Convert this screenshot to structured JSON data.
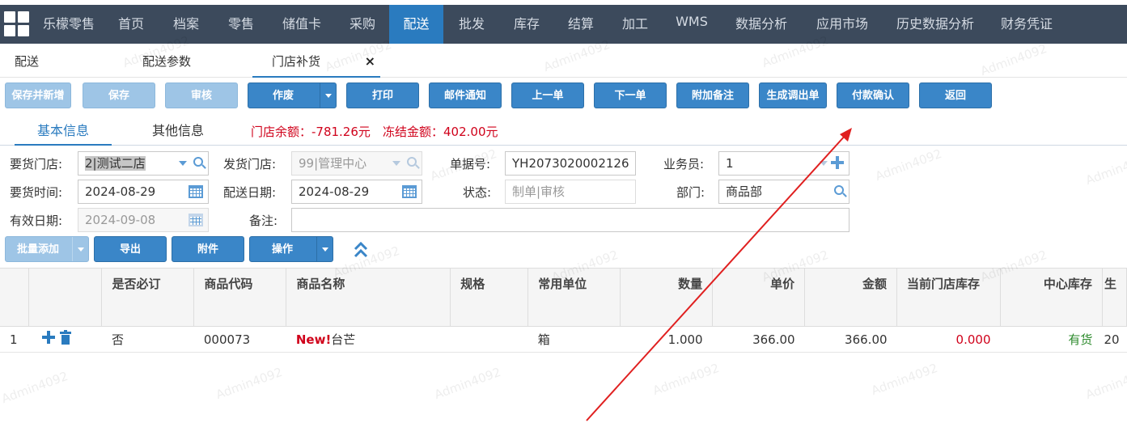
{
  "nav": {
    "items": [
      "乐檬零售",
      "首页",
      "档案",
      "零售",
      "储值卡",
      "采购",
      "配送",
      "批发",
      "库存",
      "结算",
      "加工",
      "WMS",
      "数据分析",
      "应用市场",
      "历史数据分析",
      "财务凭证"
    ],
    "active": "配送"
  },
  "tabs": [
    {
      "label": "配送"
    },
    {
      "label": "配送参数"
    },
    {
      "label": "门店补货",
      "close": "×"
    }
  ],
  "toolbar": {
    "save_new": "保存并新增",
    "save": "保存",
    "audit": "审核",
    "void": "作废",
    "print": "打印",
    "mail": "邮件通知",
    "prev": "上一单",
    "next": "下一单",
    "remark": "附加备注",
    "gen_transfer": "生成调出单",
    "pay_confirm": "付款确认",
    "back": "返回"
  },
  "subtabs": {
    "basic": "基本信息",
    "other": "其他信息"
  },
  "balance": {
    "store": "门店余额：-781.26元",
    "frozen": "冻结金额：402.00元"
  },
  "form": {
    "req_store_label": "要货门店:",
    "req_store_value": "2|测试二店",
    "ship_store_label": "发货门店:",
    "ship_store_value": "99|管理中心",
    "doc_no_label": "单据号:",
    "doc_no_value": "YH2073020002126",
    "clerk_label": "业务员:",
    "clerk_value": "1",
    "req_time_label": "要货时间:",
    "req_time_value": "2024-08-29",
    "ship_date_label": "配送日期:",
    "ship_date_value": "2024-08-29",
    "status_label": "状态:",
    "status_placeholder": "制单|审核",
    "dept_label": "部门:",
    "dept_value": "商品部",
    "valid_label": "有效日期:",
    "valid_value": "2024-09-08",
    "note_label": "备注:"
  },
  "grid_toolbar": {
    "batch_add": "批量添加",
    "export": "导出",
    "attach": "附件",
    "ops": "操作"
  },
  "columns": [
    "",
    "",
    "是否必订",
    "商品代码",
    "商品名称",
    "规格",
    "常用单位",
    "数量",
    "单价",
    "金额",
    "当前门店库存",
    "中心库存",
    "生"
  ],
  "rows": [
    {
      "no": "1",
      "required": "否",
      "code": "000073",
      "new_tag": "New!",
      "name": "台芒",
      "spec": "",
      "unit": "箱",
      "qty": "1.000",
      "price": "366.00",
      "amount": "366.00",
      "store_stock": "0.000",
      "center_stock": "有货",
      "prod": "20"
    }
  ],
  "watermark": "Admin4092",
  "colors": {
    "nav_bg": "#3c4a5c",
    "accent": "#2a7bbf",
    "danger": "#d0021b",
    "ok": "#2e8b2e",
    "arrow": "#e02020"
  }
}
